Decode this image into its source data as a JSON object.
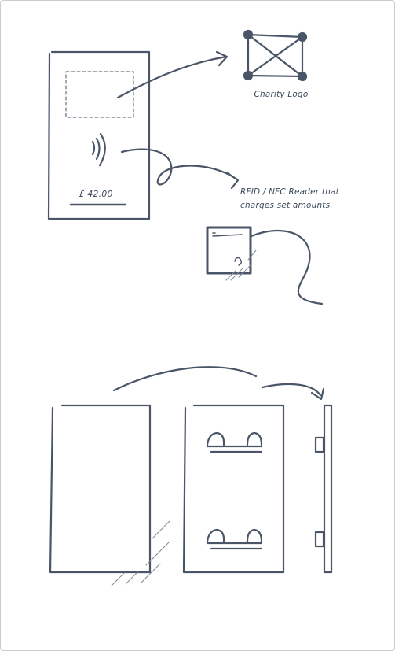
{
  "labels": {
    "charity_logo": "Charity Logo",
    "rfid_line1": "RFID / NFC Reader that",
    "rfid_line2": "charges set amounts.",
    "amount": "£ 42.00"
  },
  "colors": {
    "ink": "#4a5668",
    "frame": "#c8ccd3"
  }
}
